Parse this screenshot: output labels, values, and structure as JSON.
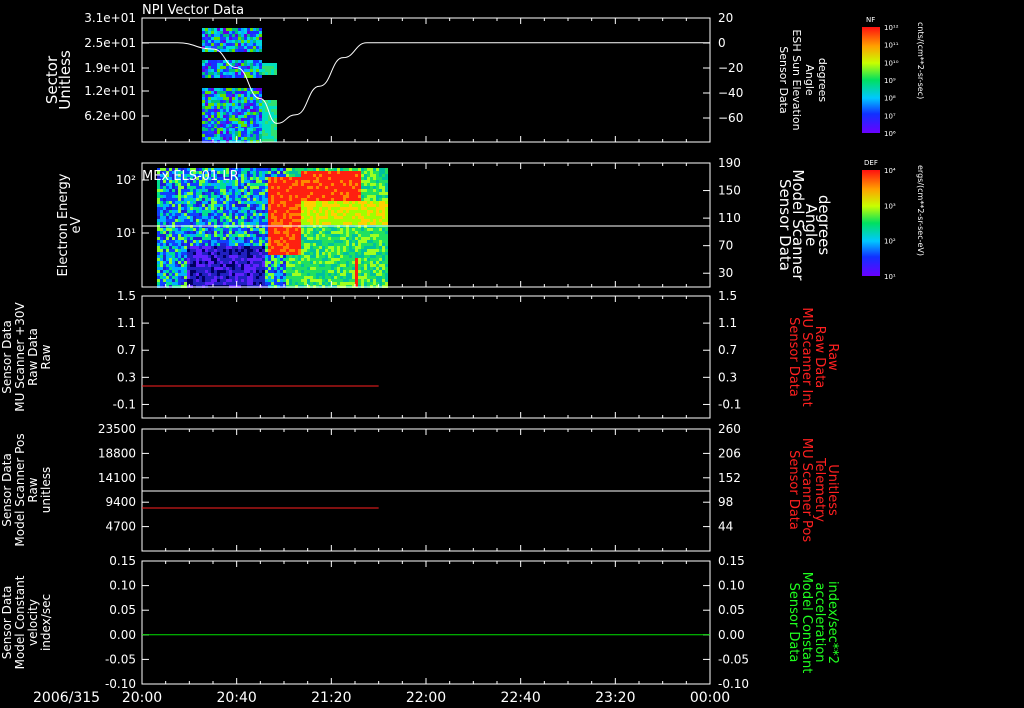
{
  "date_label": "2006/315",
  "time_ticks": [
    "20:00",
    "20:40",
    "21:20",
    "22:00",
    "22:40",
    "23:20",
    "00:00"
  ],
  "chart_data": [
    {
      "type": "heatmap",
      "title": "NPI Vector Data",
      "ylabel_left": [
        "Sector",
        "Unitless"
      ],
      "ylabel_right": [
        "Sensor Data",
        "ESH Sun Elevation",
        "Angle",
        "degrees"
      ],
      "left_ticks": [
        "3.1e+01",
        "2.5e+01",
        "1.9e+01",
        "1.2e+01",
        "6.2e+00"
      ],
      "right_ticks": [
        "20",
        "0",
        "−20",
        "−40",
        "−60"
      ],
      "right_ylim": [
        -80,
        20
      ],
      "line_series": {
        "name": "ESH Sun Elevation Angle",
        "color": "#ffffff",
        "x": [
          "20:00",
          "20:15",
          "20:30",
          "20:40",
          "20:50",
          "20:57",
          "21:05",
          "21:15",
          "21:25",
          "21:35",
          "00:00"
        ],
        "y": [
          0,
          0,
          -5,
          -20,
          -45,
          -65,
          -58,
          -35,
          -12,
          0,
          0
        ]
      },
      "data_extent": [
        "20:20",
        "20:49"
      ],
      "colorbar": {
        "label": "NF",
        "unit": "cnts/(cm**2-sr-sec)",
        "ticks": [
          "10¹²",
          "10¹¹",
          "10¹⁰",
          "10⁹",
          "10⁸",
          "10⁷",
          "10⁶"
        ]
      }
    },
    {
      "type": "heatmap",
      "title": "MEx ELS-01 LR",
      "ylabel_left": [
        "Electron Energy",
        "eV"
      ],
      "ylabel_right": [
        "Sensor Data",
        "Model Scanner",
        "Angle",
        "degrees"
      ],
      "left_ticks": [
        "10²",
        "10¹"
      ],
      "right_ticks": [
        "190",
        "150",
        "110",
        "70",
        "30"
      ],
      "right_ylim": [
        10,
        190
      ],
      "line_series": {
        "name": "Model Scanner Angle",
        "color": "#ffffff",
        "x": [
          "20:00",
          "00:00"
        ],
        "y": [
          90,
          90
        ]
      },
      "data_extent": [
        "20:00",
        "21:40"
      ],
      "colorbar": {
        "label": "DEF",
        "unit": "ergs/(cm**2-sr-sec-eV)",
        "ticks": [
          "10⁴",
          "10³",
          "10²",
          "10¹"
        ]
      }
    },
    {
      "type": "line",
      "ylabel_left": [
        "Sensor Data",
        "MU Scanner +30V",
        "Raw Data",
        "Raw"
      ],
      "ylabel_right": [
        "Sensor Data",
        "MU Scanner Int",
        "Raw Data",
        "Raw"
      ],
      "left_ticks": [
        "1.5",
        "1.1",
        "0.7",
        "0.3",
        "-0.1"
      ],
      "right_ticks": [
        "1.5",
        "1.1",
        "0.7",
        "0.3",
        "-0.1"
      ],
      "ylim": [
        -0.3,
        1.5
      ],
      "series": [
        {
          "color": "#ff2020",
          "x": [
            "20:00",
            "21:40"
          ],
          "y": [
            0,
            0
          ]
        }
      ]
    },
    {
      "type": "line",
      "ylabel_left": [
        "Sensor Data",
        "Model Scanner Pos",
        "Raw",
        "unitless"
      ],
      "ylabel_right": [
        "Sensor Data",
        "MU Scanner Pos",
        "Telemetry",
        "Unitless"
      ],
      "left_ticks": [
        "23500",
        "18800",
        "14100",
        "9400",
        "4700"
      ],
      "right_ticks": [
        "260",
        "206",
        "152",
        "98",
        "44"
      ],
      "ylim": [
        0,
        23500
      ],
      "right_ylim": [
        0,
        260
      ],
      "series": [
        {
          "color": "#ffffff",
          "x": [
            "20:00",
            "00:00"
          ],
          "y": [
            11750,
            11750
          ]
        },
        {
          "color": "#ff2020",
          "x": [
            "20:00",
            "21:40"
          ],
          "y": [
            8000,
            8000
          ]
        }
      ]
    },
    {
      "type": "line",
      "ylabel_left": [
        "Sensor Data",
        "Model Constant",
        "velocity",
        "index/sec"
      ],
      "ylabel_right": [
        "Sensor Data",
        "Model Constant",
        "acceleration",
        "index/sec**2"
      ],
      "left_ticks": [
        "0.15",
        "0.10",
        "0.05",
        "0.00",
        "-0.05",
        "-0.10"
      ],
      "right_ticks": [
        "0.15",
        "0.10",
        "0.05",
        "0.00",
        "-0.05",
        "-0.10"
      ],
      "ylim": [
        -0.1,
        0.15
      ],
      "series": [
        {
          "color": "#00e000",
          "x": [
            "20:00",
            "00:00"
          ],
          "y": [
            0,
            0
          ]
        }
      ]
    }
  ]
}
